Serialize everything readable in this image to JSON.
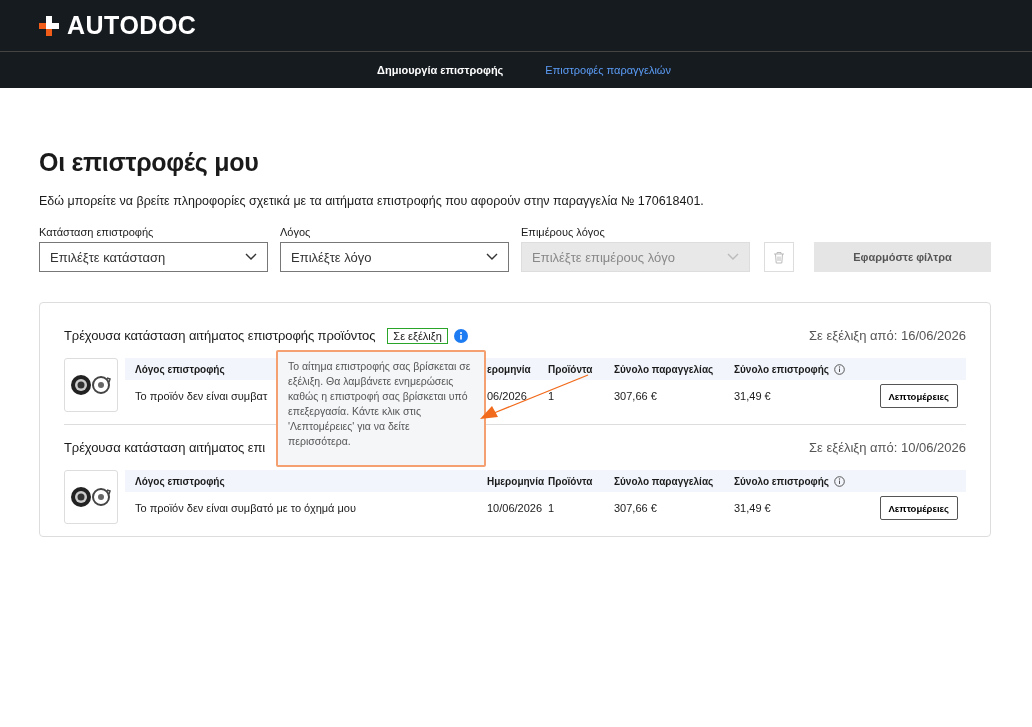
{
  "brand": {
    "name": "AUTODOC"
  },
  "nav": [
    {
      "label": "Δημιουργία επιστροφής",
      "selected": false
    },
    {
      "label": "Επιστροφές παραγγελιών",
      "selected": true
    }
  ],
  "heading": "Οι επιστροφές μου",
  "intro": "Εδώ μπορείτε να βρείτε πληροφορίες σχετικά με τα αιτήματα επιστροφής που αφορούν στην παραγγελία № 170618401.",
  "filters": [
    {
      "label": "Κατάσταση επιστροφής",
      "placeholder": "Επιλέξτε κατάσταση",
      "disabled": false
    },
    {
      "label": "Λόγος",
      "placeholder": "Επιλέξτε λόγο",
      "disabled": false
    },
    {
      "label": "Επιμέρους λόγος",
      "placeholder": "Επιλέξτε επιμέρους λόγο",
      "disabled": true
    }
  ],
  "apply_button": {
    "label": "Εφαρμόστε φίλτρα",
    "disabled": true
  },
  "returns": [
    {
      "title": "Τρέχουσα κατάσταση αιτήματος επιστροφής προϊόντος",
      "badge": "Σε εξέλιξη",
      "since": "Σε εξέλιξη από: 16/06/2026",
      "columns": [
        "Λόγος επιστροφής",
        "ερομηνία",
        "Προϊόντα",
        "Σύνολο παραγγελίας",
        "Σύνολο επιστροφής"
      ],
      "cells": [
        "Το προϊόν δεν είναι συμβατ",
        "06/2026",
        "1",
        "307,66 €",
        "31,49 €"
      ],
      "button": "Λεπτομέρειες"
    },
    {
      "title": "Τρέχουσα κατάσταση αιτήματος επι",
      "since": "Σε εξέλιξη από: 10/06/2026",
      "columns": [
        "Λόγος επιστροφής",
        "Ημερομηνία",
        "Προϊόντα",
        "Σύνολο παραγγελίας",
        "Σύνολο επιστροφής"
      ],
      "cells": [
        "Το προϊόν δεν είναι συμβατό με το όχημά μου",
        "10/06/2026",
        "1",
        "307,66 €",
        "31,49 €"
      ],
      "button": "Λεπτομέρειες"
    }
  ],
  "tooltip": "Το αίτημα επιστροφής σας βρίσκεται σε εξέλιξη. Θα λαμβάνετε ενημερώσεις καθώς η επιστροφή σας βρίσκεται υπό επεξεργασία. Κάντε κλικ στις 'Λεπτομέρειες' για να δείτε περισσότερα."
}
